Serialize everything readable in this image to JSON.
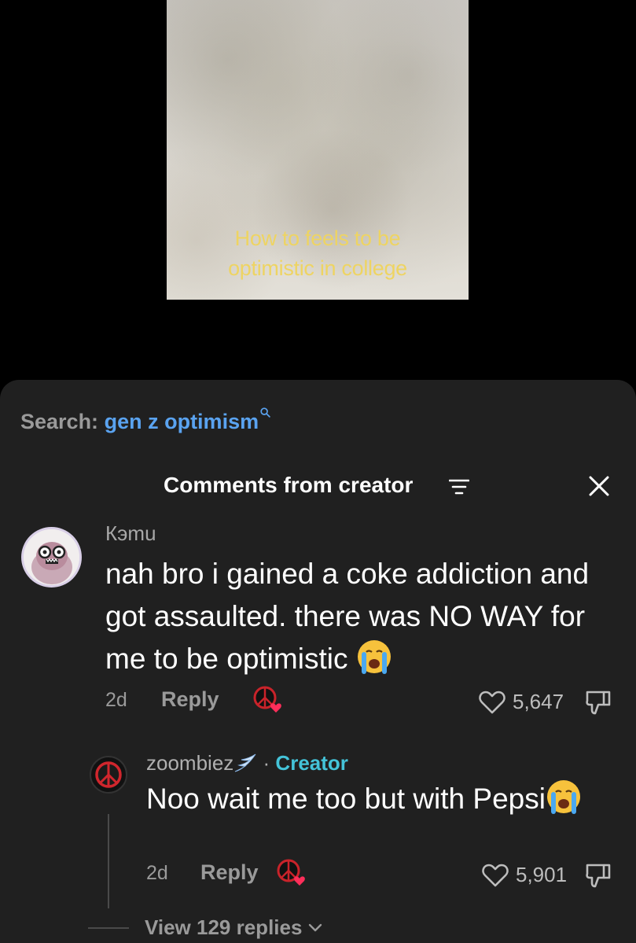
{
  "video": {
    "caption_line1": "How to feels to be",
    "caption_line2": "optimistic in college"
  },
  "search": {
    "label": "Search:",
    "query": "gen z optimism"
  },
  "header": {
    "title": "Comments from creator"
  },
  "comments": [
    {
      "username": "Кэmu",
      "text": "nah bro i gained a coke addiction and got assaulted. there was NO WAY for me to be optimistic",
      "time": "2d",
      "reply_label": "Reply",
      "likes": "5,647"
    }
  ],
  "reply": {
    "username": "zoombiez",
    "separator": "·",
    "creator_label": "Creator",
    "text": "Noo wait me too but with Pepsi",
    "time": "2d",
    "reply_label": "Reply",
    "likes": "5,901"
  },
  "view_replies": "View 129 replies",
  "colors": {
    "sheet_bg": "#202020",
    "search_query": "#5aa3f0",
    "creator": "#44c3d8",
    "caption": "#eed462"
  }
}
